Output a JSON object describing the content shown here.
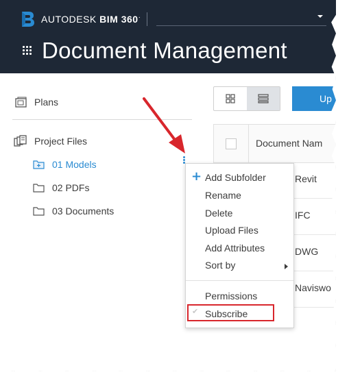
{
  "header": {
    "brand_name": "AUTODESK",
    "brand_product": "BIM 360",
    "brand_mark": "·",
    "title": "Document Management"
  },
  "sidebar": {
    "plans_label": "Plans",
    "project_files_label": "Project Files",
    "folders": [
      {
        "label": "01 Models",
        "active": true
      },
      {
        "label": "02 PDFs",
        "active": false
      },
      {
        "label": "03 Documents",
        "active": false
      }
    ]
  },
  "toolbar": {
    "upload_label": "Up"
  },
  "table": {
    "header_label": "Document Nam",
    "rows": [
      "Revit",
      "IFC",
      "DWG",
      "Naviswo"
    ]
  },
  "context_menu": {
    "items": [
      {
        "label": "Add Subfolder"
      },
      {
        "label": "Rename"
      },
      {
        "label": "Delete"
      },
      {
        "label": "Upload Files"
      },
      {
        "label": "Add Attributes"
      },
      {
        "label": "Sort by"
      },
      {
        "label": "Permissions"
      },
      {
        "label": "Subscribe"
      }
    ]
  },
  "colors": {
    "header_bg": "#1e2836",
    "accent": "#2a8bd2",
    "annotation_red": "#d8262c"
  },
  "icons": {
    "logo": "bim360-b-logo",
    "apps": "app-grid-icon",
    "plans": "plans-icon",
    "project_files": "project-files-icon",
    "folder": "folder-icon",
    "kebab": "vertical-ellipsis-icon",
    "grid_view": "grid-view-icon",
    "list_view": "list-view-icon",
    "add": "plus-icon",
    "submenu": "caret-right-icon",
    "check": "check-icon",
    "annotation_arrow": "red-arrow"
  }
}
